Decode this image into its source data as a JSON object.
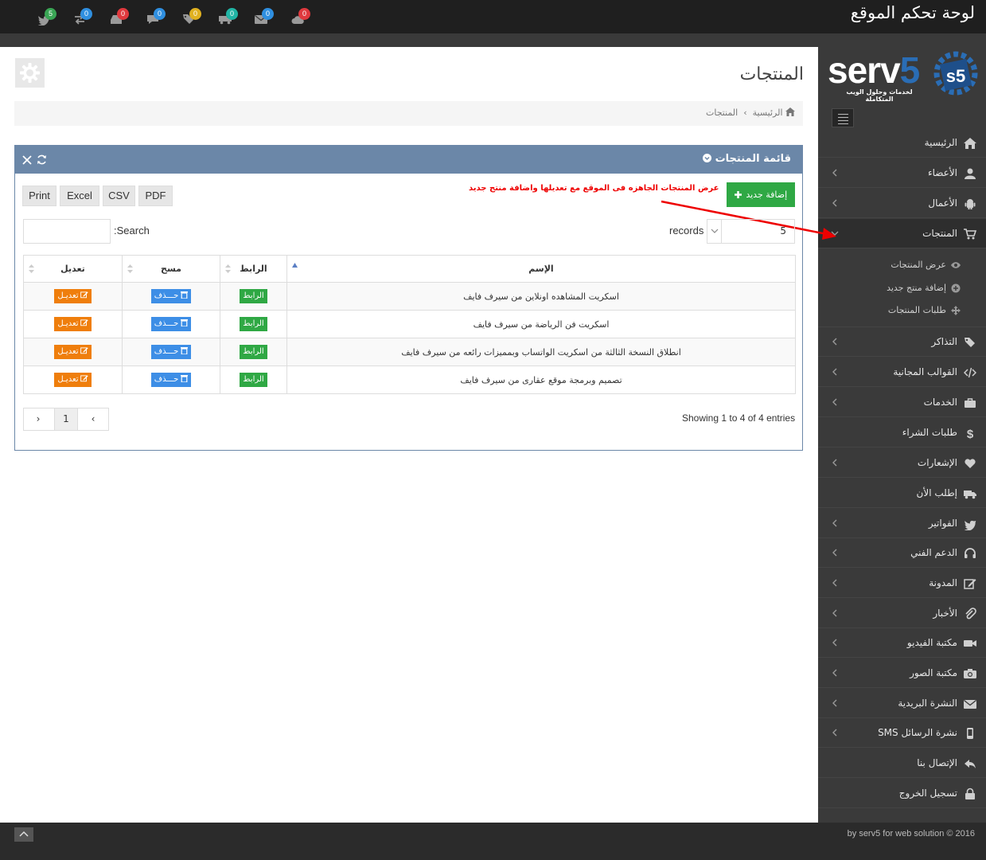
{
  "header": {
    "title": "لوحة تحكم الموقع",
    "notifications": [
      {
        "icon": "twitter-icon",
        "count": "5",
        "color": "#3aa655"
      },
      {
        "icon": "exchange-icon",
        "count": "0",
        "color": "#2f8fe0"
      },
      {
        "icon": "inbox-icon",
        "count": "0",
        "color": "#e0393e"
      },
      {
        "icon": "comment-icon",
        "count": "0",
        "color": "#2f8fe0"
      },
      {
        "icon": "tags-icon",
        "count": "0",
        "color": "#e0b120"
      },
      {
        "icon": "truck-icon",
        "count": "0",
        "color": "#21b5a5"
      },
      {
        "icon": "envelope-icon",
        "count": "0",
        "color": "#2f8fe0"
      },
      {
        "icon": "cloud-icon",
        "count": "0",
        "color": "#e0393e"
      }
    ]
  },
  "logo": {
    "text_main": "serv",
    "text_five": "5",
    "tagline": "لخدمات وحلول الويب المتكاملة",
    "mark": "s5"
  },
  "sidebar": {
    "items": [
      {
        "label": "الرئيسية",
        "icon": "home-icon",
        "chevron": false
      },
      {
        "label": "الأعضاء",
        "icon": "user-icon",
        "chevron": true
      },
      {
        "label": "الأعمال",
        "icon": "android-icon",
        "chevron": true
      },
      {
        "label": "المنتجات",
        "icon": "cart-icon",
        "chevron": true,
        "active": true
      },
      {
        "label": "التذاكر",
        "icon": "tags-icon",
        "chevron": true
      },
      {
        "label": "القوالب المجانية",
        "icon": "code-icon",
        "chevron": true
      },
      {
        "label": "الخدمات",
        "icon": "briefcase-icon",
        "chevron": true
      },
      {
        "label": "طلبات الشراء",
        "icon": "dollar-icon",
        "chevron": false
      },
      {
        "label": "الإشعارات",
        "icon": "heart-icon",
        "chevron": true
      },
      {
        "label": "إطلب الأن",
        "icon": "truck-icon",
        "chevron": false
      },
      {
        "label": "الفواتير",
        "icon": "twitter-icon",
        "chevron": true
      },
      {
        "label": "الدعم الفني",
        "icon": "headphones-icon",
        "chevron": true
      },
      {
        "label": "المدونة",
        "icon": "edit-icon",
        "chevron": true
      },
      {
        "label": "الأخبار",
        "icon": "paperclip-icon",
        "chevron": true
      },
      {
        "label": "مكتبة الفيديو",
        "icon": "video-icon",
        "chevron": true
      },
      {
        "label": "مكتبة الصور",
        "icon": "camera-icon",
        "chevron": true
      },
      {
        "label": "النشرة البريدية",
        "icon": "envelope-icon",
        "chevron": true
      },
      {
        "label": "نشرة الرسائل SMS",
        "icon": "mobile-icon",
        "chevron": true
      },
      {
        "label": "الإتصال بنا",
        "icon": "reply-icon",
        "chevron": false
      },
      {
        "label": "تسجيل الخروج",
        "icon": "lock-icon",
        "chevron": false
      }
    ],
    "submenu": [
      {
        "label": "عرض المنتجات",
        "icon": "eye-icon"
      },
      {
        "label": "إضافة منتج جديد",
        "icon": "plus-circle-icon"
      },
      {
        "label": "طلبات المنتجات",
        "icon": "arrows-icon"
      }
    ]
  },
  "page": {
    "title": "المنتجات",
    "breadcrumb": {
      "home": "الرئيسية",
      "sep": "›",
      "current": "المنتجات"
    }
  },
  "panel": {
    "title": "قائمة المنتجات",
    "add_button": "إضافة جديد",
    "hint": "عرض المنتجات الجاهزه فى الموقع مع تعديلها واضافة منتج جديد",
    "export": [
      "Print",
      "Excel",
      "CSV",
      "PDF"
    ],
    "search_label": ":Search",
    "records_label": "records",
    "records_value": "5",
    "columns": [
      "الإسم",
      "الرابط",
      "مسح",
      "تعديل"
    ],
    "rows": [
      {
        "name": "اسكريت المشاهده اونلاين من سيرف فايف",
        "link": "الرابط",
        "delete": "حـــذف",
        "edit": "تعديـل"
      },
      {
        "name": "اسكريت فن الرياضة من سيرف فايف",
        "link": "الرابط",
        "delete": "حـــذف",
        "edit": "تعديـل"
      },
      {
        "name": "انطلاق النسخة الثالثة من اسكريت الواتساب وبمميزات رائعه من سيرف فايف",
        "link": "الرابط",
        "delete": "حـــذف",
        "edit": "تعديـل"
      },
      {
        "name": "تصميم وبرمجة موقع عقارى من سيرف فايف",
        "link": "الرابط",
        "delete": "حـــذف",
        "edit": "تعديـل"
      }
    ],
    "showing": "Showing 1 to 4 of 4 entries",
    "pager": {
      "prev": "‹",
      "current": "1",
      "next": "›"
    }
  },
  "footer": {
    "text": "by serv5 for web solution © 2016"
  }
}
